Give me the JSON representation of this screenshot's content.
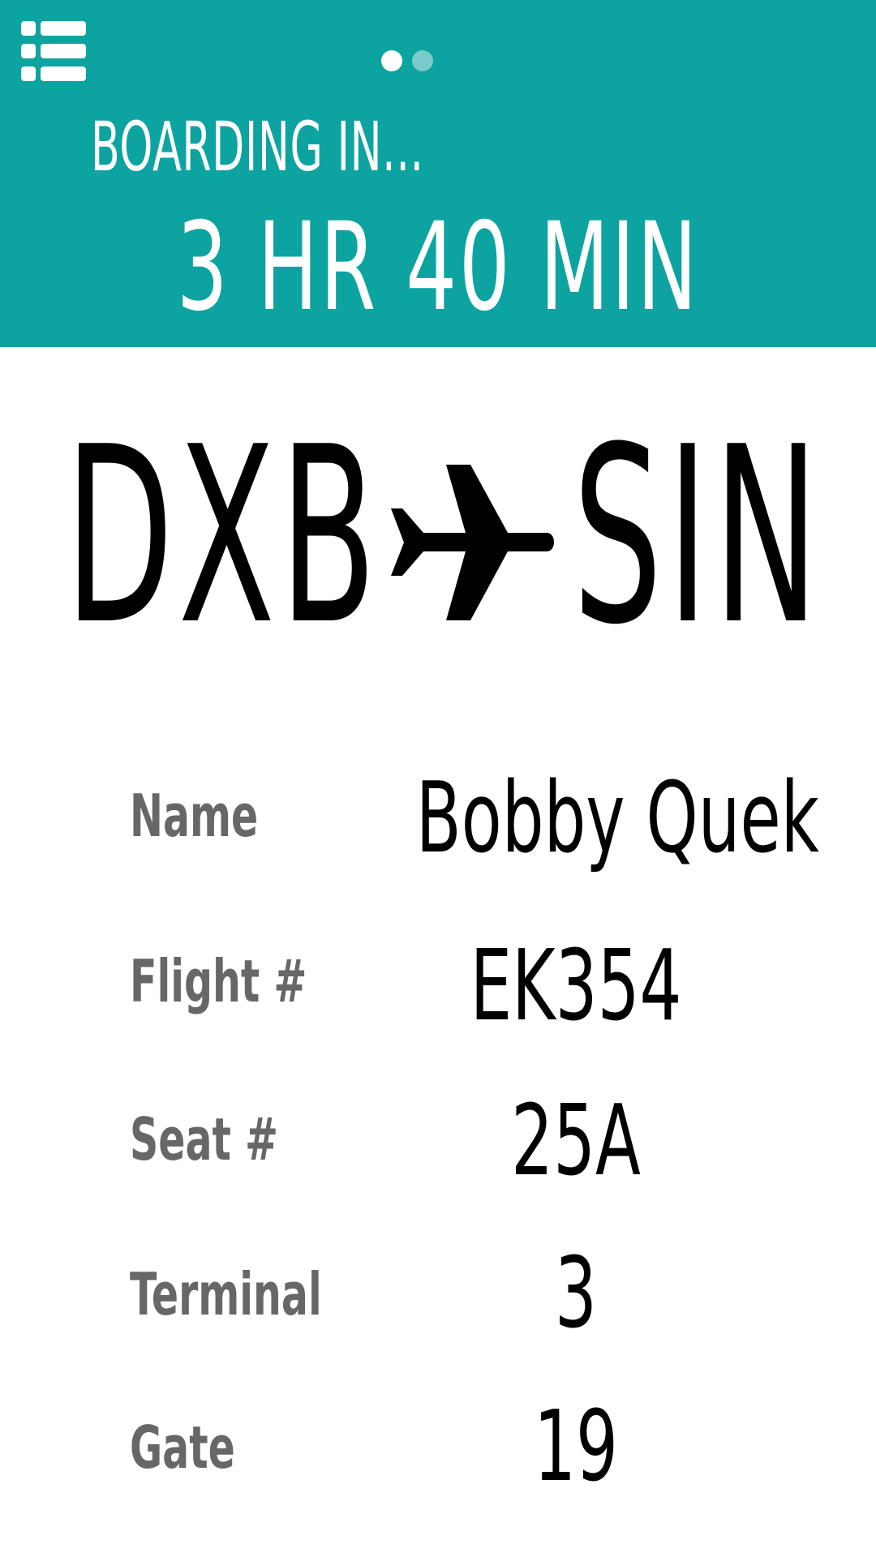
{
  "header": {
    "menu_icon": "list-menu-icon",
    "page_indicator": {
      "count": 2,
      "active": 1
    },
    "boarding_label": "BOARDING IN...",
    "countdown": "3 HR 40 MIN",
    "background_color": "#0ca3a0"
  },
  "route": {
    "origin": "DXB",
    "destination": "SIN",
    "icon": "airplane-icon"
  },
  "details": {
    "name": {
      "label": "Name",
      "value": "Bobby Quek"
    },
    "flight": {
      "label": "Flight #",
      "value": "EK354"
    },
    "seat": {
      "label": "Seat #",
      "value": "25A"
    },
    "terminal": {
      "label": "Terminal",
      "value": "3"
    },
    "gate": {
      "label": "Gate",
      "value": "19"
    }
  }
}
